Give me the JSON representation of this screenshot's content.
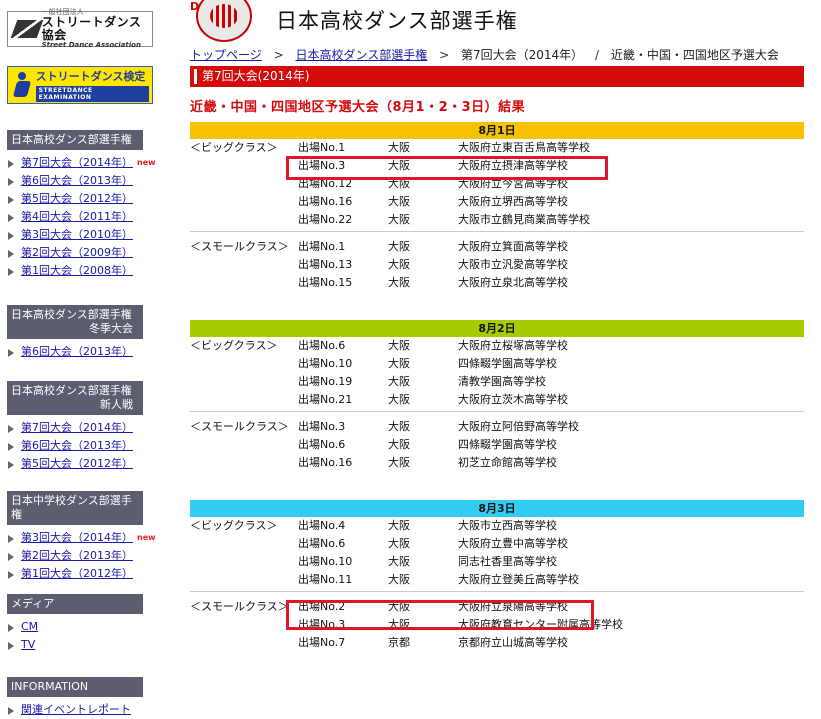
{
  "sidebar": {
    "assoc_logo": {
      "line1": "一般社団法人",
      "line2": "ストリートダンス協会",
      "line3": "Street Dance Association"
    },
    "exam_banner": {
      "title": "ストリートダンス検定",
      "subtitle": "STREETDANCE EXAMINATION"
    },
    "sections": [
      {
        "header": "日本高校ダンス部選手権",
        "header_sub": "",
        "items": [
          {
            "label": "第7回大会（2014年）",
            "new": "new"
          },
          {
            "label": "第6回大会（2013年）"
          },
          {
            "label": "第5回大会（2012年）"
          },
          {
            "label": "第4回大会（2011年）"
          },
          {
            "label": "第3回大会（2010年）"
          },
          {
            "label": "第2回大会（2009年）"
          },
          {
            "label": "第1回大会（2008年）"
          }
        ]
      },
      {
        "header": "日本高校ダンス部選手権",
        "header_sub": "冬季大会",
        "items": [
          {
            "label": "第6回大会（2013年）"
          }
        ]
      },
      {
        "header": "日本高校ダンス部選手権",
        "header_sub": "新人戦",
        "items": [
          {
            "label": "第7回大会（2014年）"
          },
          {
            "label": "第6回大会（2013年）"
          },
          {
            "label": "第5回大会（2012年）"
          }
        ]
      },
      {
        "header": "日本中学校ダンス部選手権",
        "header_sub": "",
        "items": [
          {
            "label": "第3回大会（2014年）",
            "new": "new"
          },
          {
            "label": "第2回大会（2013年）"
          },
          {
            "label": "第1回大会（2012年）"
          }
        ]
      },
      {
        "header": "メディア",
        "header_sub": "",
        "items": [
          {
            "label": "CM"
          },
          {
            "label": "TV"
          }
        ]
      },
      {
        "header": "INFORMATION",
        "header_sub": "",
        "items": [
          {
            "label": "関連イベントレポート"
          }
        ]
      }
    ]
  },
  "main": {
    "emblem_letter": "D",
    "site_title": "日本高校ダンス部選手権",
    "breadcrumb": {
      "home": "トップページ",
      "championship": "日本高校ダンス部選手権",
      "tournament": "第7回大会（2014年）",
      "slash": "/",
      "current": "近畿・中国・四国地区予選大会",
      "sep": ">"
    },
    "red_bar": "第7回大会(2014年)",
    "results_title": "近畿・中国・四国地区予選大会（8月1・2・3日）結果",
    "days": [
      {
        "label": "8月1日",
        "groups": [
          {
            "class": "＜ビッグクラス＞",
            "rows": [
              {
                "entry": "出場No.1",
                "pref": "大阪",
                "school": "大阪府立東百舌鳥高等学校"
              },
              {
                "entry": "出場No.3",
                "pref": "大阪",
                "school": "大阪府立摂津高等学校"
              },
              {
                "entry": "出場No.12",
                "pref": "大阪",
                "school": "大阪府立今宮高等学校"
              },
              {
                "entry": "出場No.16",
                "pref": "大阪",
                "school": "大阪府立堺西高等学校"
              },
              {
                "entry": "出場No.22",
                "pref": "大阪",
                "school": "大阪市立鶴見商業高等学校"
              }
            ]
          },
          {
            "class": "＜スモールクラス＞",
            "rows": [
              {
                "entry": "出場No.1",
                "pref": "大阪",
                "school": "大阪府立箕面高等学校"
              },
              {
                "entry": "出場No.13",
                "pref": "大阪",
                "school": "大阪市立汎愛高等学校"
              },
              {
                "entry": "出場No.15",
                "pref": "大阪",
                "school": "大阪府立泉北高等学校"
              }
            ]
          }
        ]
      },
      {
        "label": "8月2日",
        "groups": [
          {
            "class": "＜ビッグクラス＞",
            "rows": [
              {
                "entry": "出場No.6",
                "pref": "大阪",
                "school": "大阪府立桜塚高等学校"
              },
              {
                "entry": "出場No.10",
                "pref": "大阪",
                "school": "四條畷学園高等学校"
              },
              {
                "entry": "出場No.19",
                "pref": "大阪",
                "school": "清教学園高等学校"
              },
              {
                "entry": "出場No.21",
                "pref": "大阪",
                "school": "大阪府立茨木高等学校"
              }
            ]
          },
          {
            "class": "＜スモールクラス＞",
            "rows": [
              {
                "entry": "出場No.3",
                "pref": "大阪",
                "school": "大阪府立阿倍野高等学校"
              },
              {
                "entry": "出場No.6",
                "pref": "大阪",
                "school": "四條畷学園高等学校"
              },
              {
                "entry": "出場No.16",
                "pref": "大阪",
                "school": "初芝立命館高等学校"
              }
            ]
          }
        ]
      },
      {
        "label": "8月3日",
        "groups": [
          {
            "class": "＜ビッグクラス＞",
            "rows": [
              {
                "entry": "出場No.4",
                "pref": "大阪",
                "school": "大阪市立西高等学校"
              },
              {
                "entry": "出場No.6",
                "pref": "大阪",
                "school": "大阪府立豊中高等学校"
              },
              {
                "entry": "出場No.10",
                "pref": "大阪",
                "school": "同志社香里高等学校"
              },
              {
                "entry": "出場No.11",
                "pref": "大阪",
                "school": "大阪府立登美丘高等学校"
              }
            ]
          },
          {
            "class": "＜スモールクラス＞",
            "rows": [
              {
                "entry": "出場No.2",
                "pref": "大阪",
                "school": "大阪府立泉陽高等学校"
              },
              {
                "entry": "出場No.3",
                "pref": "大阪",
                "school": "大阪府教育センター附属高等学校"
              },
              {
                "entry": "出場No.7",
                "pref": "京都",
                "school": "京都府立山城高等学校"
              }
            ]
          }
        ]
      }
    ]
  },
  "colors": {
    "red_bar": "#d40b0b",
    "day_1": "#f7c300",
    "day_2": "#a6cc00",
    "day_3": "#33ccf2",
    "sidebar_header": "#5c5e70",
    "highlight": "#e0142a",
    "link": "#1a1aa6"
  }
}
